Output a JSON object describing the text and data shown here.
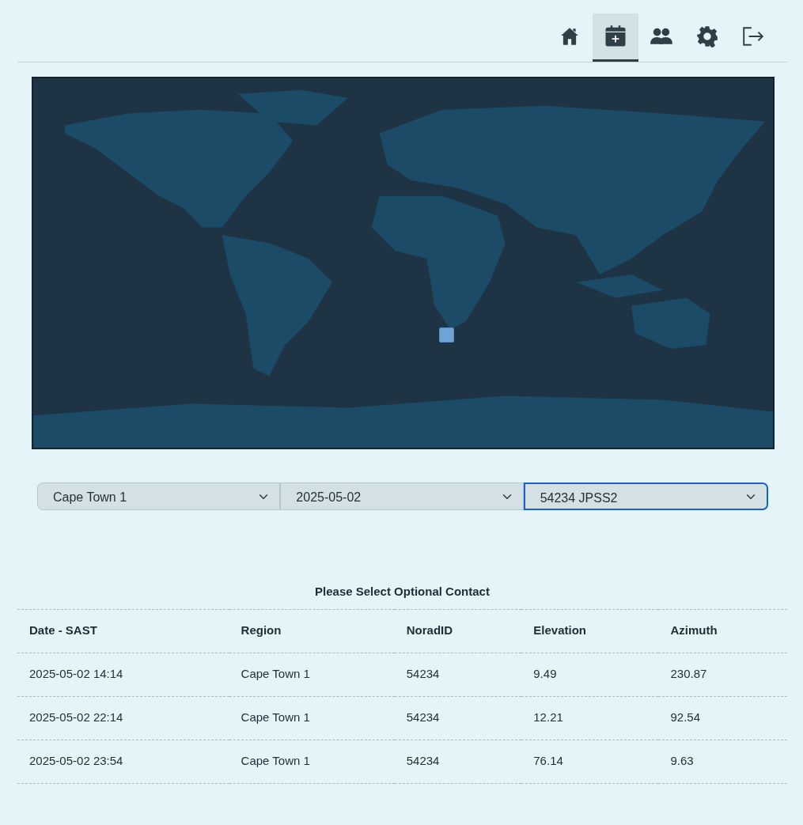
{
  "nav": [
    {
      "selected": false
    },
    {
      "selected": true
    },
    {
      "selected": false
    },
    {
      "selected": false
    },
    {
      "selected": false
    }
  ],
  "filters": [
    {
      "value": "Cape Town 1",
      "focused": false
    },
    {
      "value": "2025-05-02",
      "focused": false
    },
    {
      "value": "54234 JPSS2",
      "focused": true
    }
  ],
  "table": {
    "title": "Please Select Optional Contact",
    "columns": [
      "Date - SAST",
      "Region",
      "NoradID",
      "Elevation",
      "Azimuth"
    ],
    "rows": [
      [
        "2025-05-02 14:14",
        "Cape Town 1",
        "54234",
        "9.49",
        "230.87"
      ],
      [
        "2025-05-02 22:14",
        "Cape Town 1",
        "54234",
        "12.21",
        "92.54"
      ],
      [
        "2025-05-02 23:54",
        "Cape Town 1",
        "54234",
        "76.14",
        "9.63"
      ]
    ]
  }
}
